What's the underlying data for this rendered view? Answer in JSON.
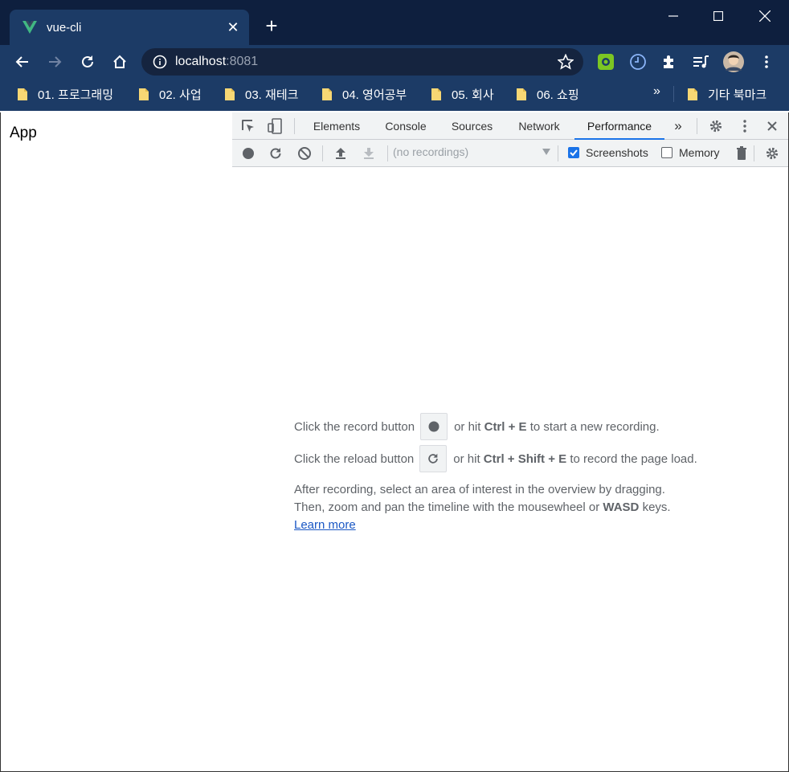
{
  "window": {
    "tab_title": "vue-cli",
    "new_tab_symbol": "+",
    "tab_close_symbol": "✕"
  },
  "toolbar": {
    "url_host": "localhost",
    "url_port": ":8081"
  },
  "bookmarks": {
    "items": [
      {
        "label": "01. 프로그래밍"
      },
      {
        "label": "02. 사업"
      },
      {
        "label": "03. 재테크"
      },
      {
        "label": "04. 영어공부"
      },
      {
        "label": "05. 회사"
      },
      {
        "label": "06. 쇼핑"
      }
    ],
    "overflow_symbol": "»",
    "other_label": "기타 북마크"
  },
  "page": {
    "app_text": "App"
  },
  "devtools": {
    "tabs": [
      {
        "label": "Elements"
      },
      {
        "label": "Console"
      },
      {
        "label": "Sources"
      },
      {
        "label": "Network"
      },
      {
        "label": "Performance"
      }
    ],
    "active_tab": "Performance",
    "more_tabs_symbol": "»",
    "recordings_placeholder": "(no recordings)",
    "screenshots_label": "Screenshots",
    "screenshots_checked": true,
    "memory_label": "Memory",
    "memory_checked": false,
    "landing": {
      "record_prefix": "Click the record button",
      "record_mid": "or hit",
      "record_keys": "Ctrl + E",
      "record_suffix": "to start a new recording.",
      "reload_prefix": "Click the reload button",
      "reload_mid": "or hit",
      "reload_keys": "Ctrl + Shift + E",
      "reload_suffix": "to record the page load.",
      "after_line1": "After recording, select an area of interest in the overview by dragging.",
      "after_line2_prefix": "Then, zoom and pan the timeline with the mousewheel or",
      "after_line2_keys": "WASD",
      "after_line2_suffix": "keys.",
      "learn_more": "Learn more"
    }
  },
  "colors": {
    "titlebar_bg": "#0e1f3e",
    "toolbar_bg": "#1c3b66",
    "accent": "#1a73e8",
    "vue_green": "#41b883"
  }
}
